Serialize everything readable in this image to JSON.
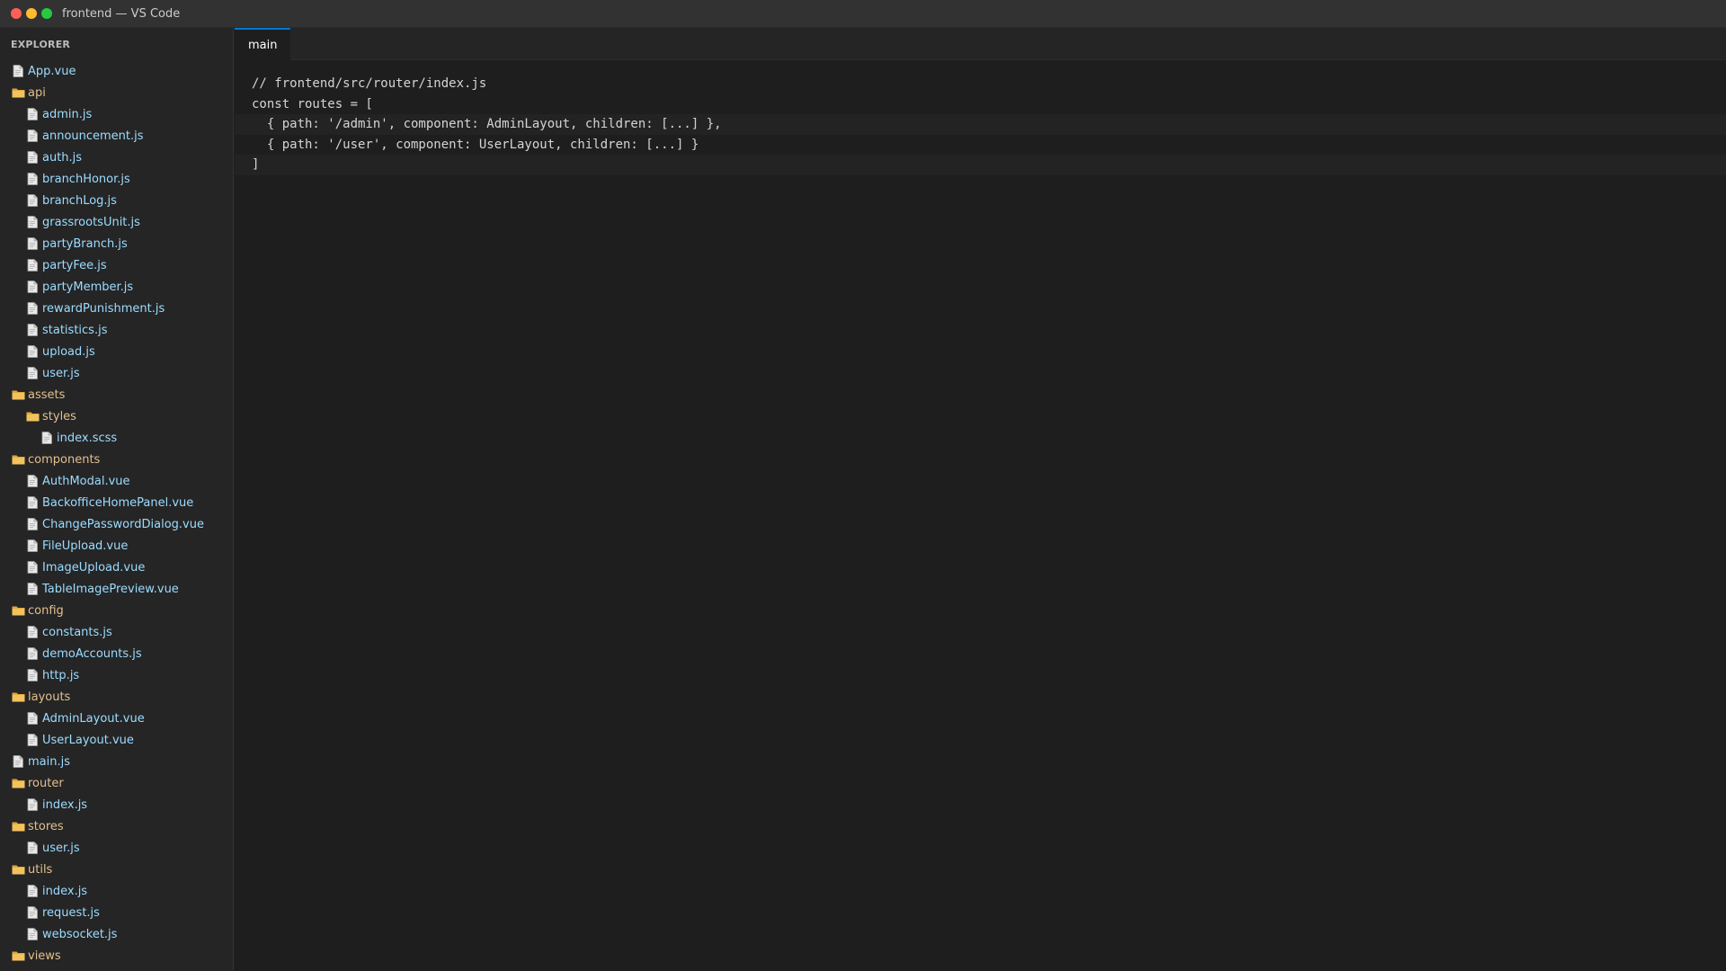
{
  "window": {
    "title": "frontend — VS Code"
  },
  "sidebar": {
    "header": "EXPLORER",
    "items": [
      {
        "label": "App.vue",
        "type": "file",
        "depth": 0
      },
      {
        "label": "api",
        "type": "folder",
        "depth": 0
      },
      {
        "label": "admin.js",
        "type": "file",
        "depth": 1
      },
      {
        "label": "announcement.js",
        "type": "file",
        "depth": 1
      },
      {
        "label": "auth.js",
        "type": "file",
        "depth": 1
      },
      {
        "label": "branchHonor.js",
        "type": "file",
        "depth": 1
      },
      {
        "label": "branchLog.js",
        "type": "file",
        "depth": 1
      },
      {
        "label": "grassrootsUnit.js",
        "type": "file",
        "depth": 1
      },
      {
        "label": "partyBranch.js",
        "type": "file",
        "depth": 1
      },
      {
        "label": "partyFee.js",
        "type": "file",
        "depth": 1
      },
      {
        "label": "partyMember.js",
        "type": "file",
        "depth": 1
      },
      {
        "label": "rewardPunishment.js",
        "type": "file",
        "depth": 1
      },
      {
        "label": "statistics.js",
        "type": "file",
        "depth": 1
      },
      {
        "label": "upload.js",
        "type": "file",
        "depth": 1
      },
      {
        "label": "user.js",
        "type": "file",
        "depth": 1
      },
      {
        "label": "assets",
        "type": "folder",
        "depth": 0
      },
      {
        "label": "styles",
        "type": "folder",
        "depth": 1
      },
      {
        "label": "index.scss",
        "type": "file",
        "depth": 2
      },
      {
        "label": "components",
        "type": "folder",
        "depth": 0
      },
      {
        "label": "AuthModal.vue",
        "type": "file",
        "depth": 1
      },
      {
        "label": "BackofficeHomePanel.vue",
        "type": "file",
        "depth": 1
      },
      {
        "label": "ChangePasswordDialog.vue",
        "type": "file",
        "depth": 1
      },
      {
        "label": "FileUpload.vue",
        "type": "file",
        "depth": 1
      },
      {
        "label": "ImageUpload.vue",
        "type": "file",
        "depth": 1
      },
      {
        "label": "TableImagePreview.vue",
        "type": "file",
        "depth": 1
      },
      {
        "label": "config",
        "type": "folder",
        "depth": 0
      },
      {
        "label": "constants.js",
        "type": "file",
        "depth": 1
      },
      {
        "label": "demoAccounts.js",
        "type": "file",
        "depth": 1
      },
      {
        "label": "http.js",
        "type": "file",
        "depth": 1
      },
      {
        "label": "layouts",
        "type": "folder",
        "depth": 0
      },
      {
        "label": "AdminLayout.vue",
        "type": "file",
        "depth": 1
      },
      {
        "label": "UserLayout.vue",
        "type": "file",
        "depth": 1
      },
      {
        "label": "main.js",
        "type": "file",
        "depth": 0
      },
      {
        "label": "router",
        "type": "folder",
        "depth": 0
      },
      {
        "label": "index.js",
        "type": "file",
        "depth": 1
      },
      {
        "label": "stores",
        "type": "folder",
        "depth": 0
      },
      {
        "label": "user.js",
        "type": "file",
        "depth": 1
      },
      {
        "label": "utils",
        "type": "folder",
        "depth": 0
      },
      {
        "label": "index.js",
        "type": "file",
        "depth": 1
      },
      {
        "label": "request.js",
        "type": "file",
        "depth": 1
      },
      {
        "label": "websocket.js",
        "type": "file",
        "depth": 1
      },
      {
        "label": "views",
        "type": "folder",
        "depth": 0
      }
    ]
  },
  "tabs": [
    {
      "label": "main",
      "active": true
    }
  ],
  "editor": {
    "lines": [
      {
        "text": "// frontend/src/router/index.js",
        "highlighted": false
      },
      {
        "text": "const routes = [",
        "highlighted": false
      },
      {
        "text": "  { path: '/admin', component: AdminLayout, children: [...] },",
        "highlighted": true
      },
      {
        "text": "  { path: '/user', component: UserLayout, children: [...] }",
        "highlighted": false
      },
      {
        "text": "]",
        "highlighted": true
      }
    ]
  },
  "icons": {
    "file": "file-icon",
    "folder": "folder-icon"
  },
  "colors": {
    "accent": "#0078d4",
    "file_label": "#9cdcfe",
    "folder_label": "#e2c08d",
    "editor_bg": "#1e1e1e",
    "sidebar_bg": "#252526"
  }
}
